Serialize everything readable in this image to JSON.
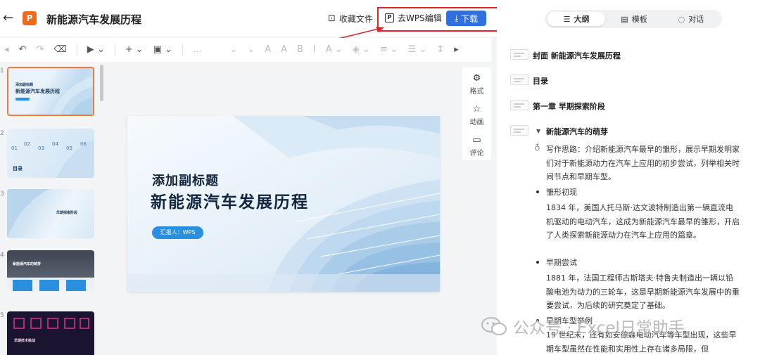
{
  "topbar": {
    "title": "新能源汽车发展历程",
    "logo_letter": "P",
    "fav_label": "收藏文件",
    "wps_label": "去WPS编辑",
    "download_label": "下载"
  },
  "toolbar": {
    "items": [
      "↶",
      "↷",
      "⌫",
      "▶ ⌄",
      "+ ⌄",
      "▣ ⌄",
      "...",
      "⌄",
      "⌄",
      "A",
      "A",
      "B",
      "I",
      "A ⌄",
      "◈ ⌄",
      "≡ ⌄",
      "☰ ⌄",
      "↕",
      "▸"
    ]
  },
  "thumbnails": {
    "items": [
      {
        "num": "1",
        "title_small": "添加副标题",
        "title": "新能源汽车发展历程"
      },
      {
        "num": "2",
        "title": "目录"
      },
      {
        "num": "3",
        "title": "早期探索阶段"
      },
      {
        "num": "4",
        "title": "新能源汽车的萌芽"
      },
      {
        "num": "5",
        "title": "早期技术挑战"
      }
    ]
  },
  "slide": {
    "subtitle": "添加副标题",
    "title": "新能源汽车发展历程",
    "tag": "汇报人：WPS"
  },
  "side_tools": {
    "format": "格式",
    "animation": "动画",
    "comment": "评论"
  },
  "right_panel": {
    "tabs": [
      {
        "label": "大纲",
        "icon": "list-icon",
        "active": true
      },
      {
        "label": "模板",
        "icon": "template-icon",
        "active": false
      },
      {
        "label": "对话",
        "icon": "chat-icon",
        "active": false
      }
    ],
    "outline": {
      "cover": "封面 新能源汽车发展历程",
      "toc": "目录",
      "chapter1": "第一章 早期探索阶段",
      "section1": "新能源汽车的萌芽",
      "writing_idea": "写作思路：介绍新能源汽车最早的雏形，展示早期发明家们对于新能源动力在汽车上应用的初步尝试，列举相关时间节点和早期车型。",
      "bullet1": "雏形初现",
      "bullet1_text": "1834 年，美国人托马斯·达文波特制造出第一辆直流电机驱动的电动汽车，这成为新能源汽车最早的雏形，开启了人类探索新能源动力在汽车上应用的篇章。",
      "bullet2": "早期尝试",
      "bullet2_text": "1881 年，法国工程师古斯塔夫·特鲁夫制造出一辆以铅酸电池为动力的三轮车，这是早期新能源汽车发展中的重要尝试，为后续的研究奠定了基础。",
      "bullet3": "早期车型举例",
      "bullet3_text": "19 世纪末，还有如安德森电动汽车等车型出现，这些早期车型虽然在性能和实用性上存在诸多局限，但"
    }
  },
  "watermark": "公众号 · Excel日常助手"
}
